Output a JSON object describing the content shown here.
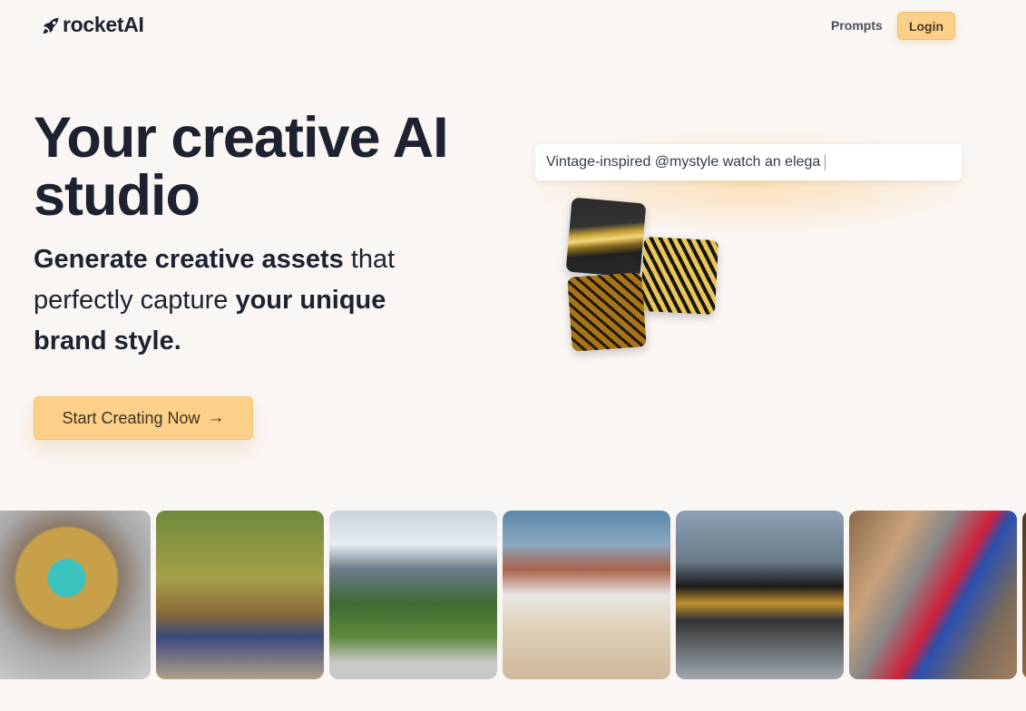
{
  "nav": {
    "logo_text": "rocketAI",
    "logo_icon": "rocket-icon",
    "links": [
      {
        "label": "Prompts"
      }
    ],
    "login_label": "Login"
  },
  "hero": {
    "title": "Your creative AI studio",
    "subtitle_parts": {
      "b1": "Generate creative assets",
      "t1": " that perfectly capture ",
      "b2": "your unique brand style."
    },
    "cta_label": "Start Creating Now",
    "cta_icon": "arrow-right-icon"
  },
  "prompt_demo": {
    "text": "Vintage-inspired @mystyle watch an elega"
  },
  "colors": {
    "accent": "#fcd088",
    "background": "#faf6f4",
    "text": "#1c2230"
  }
}
